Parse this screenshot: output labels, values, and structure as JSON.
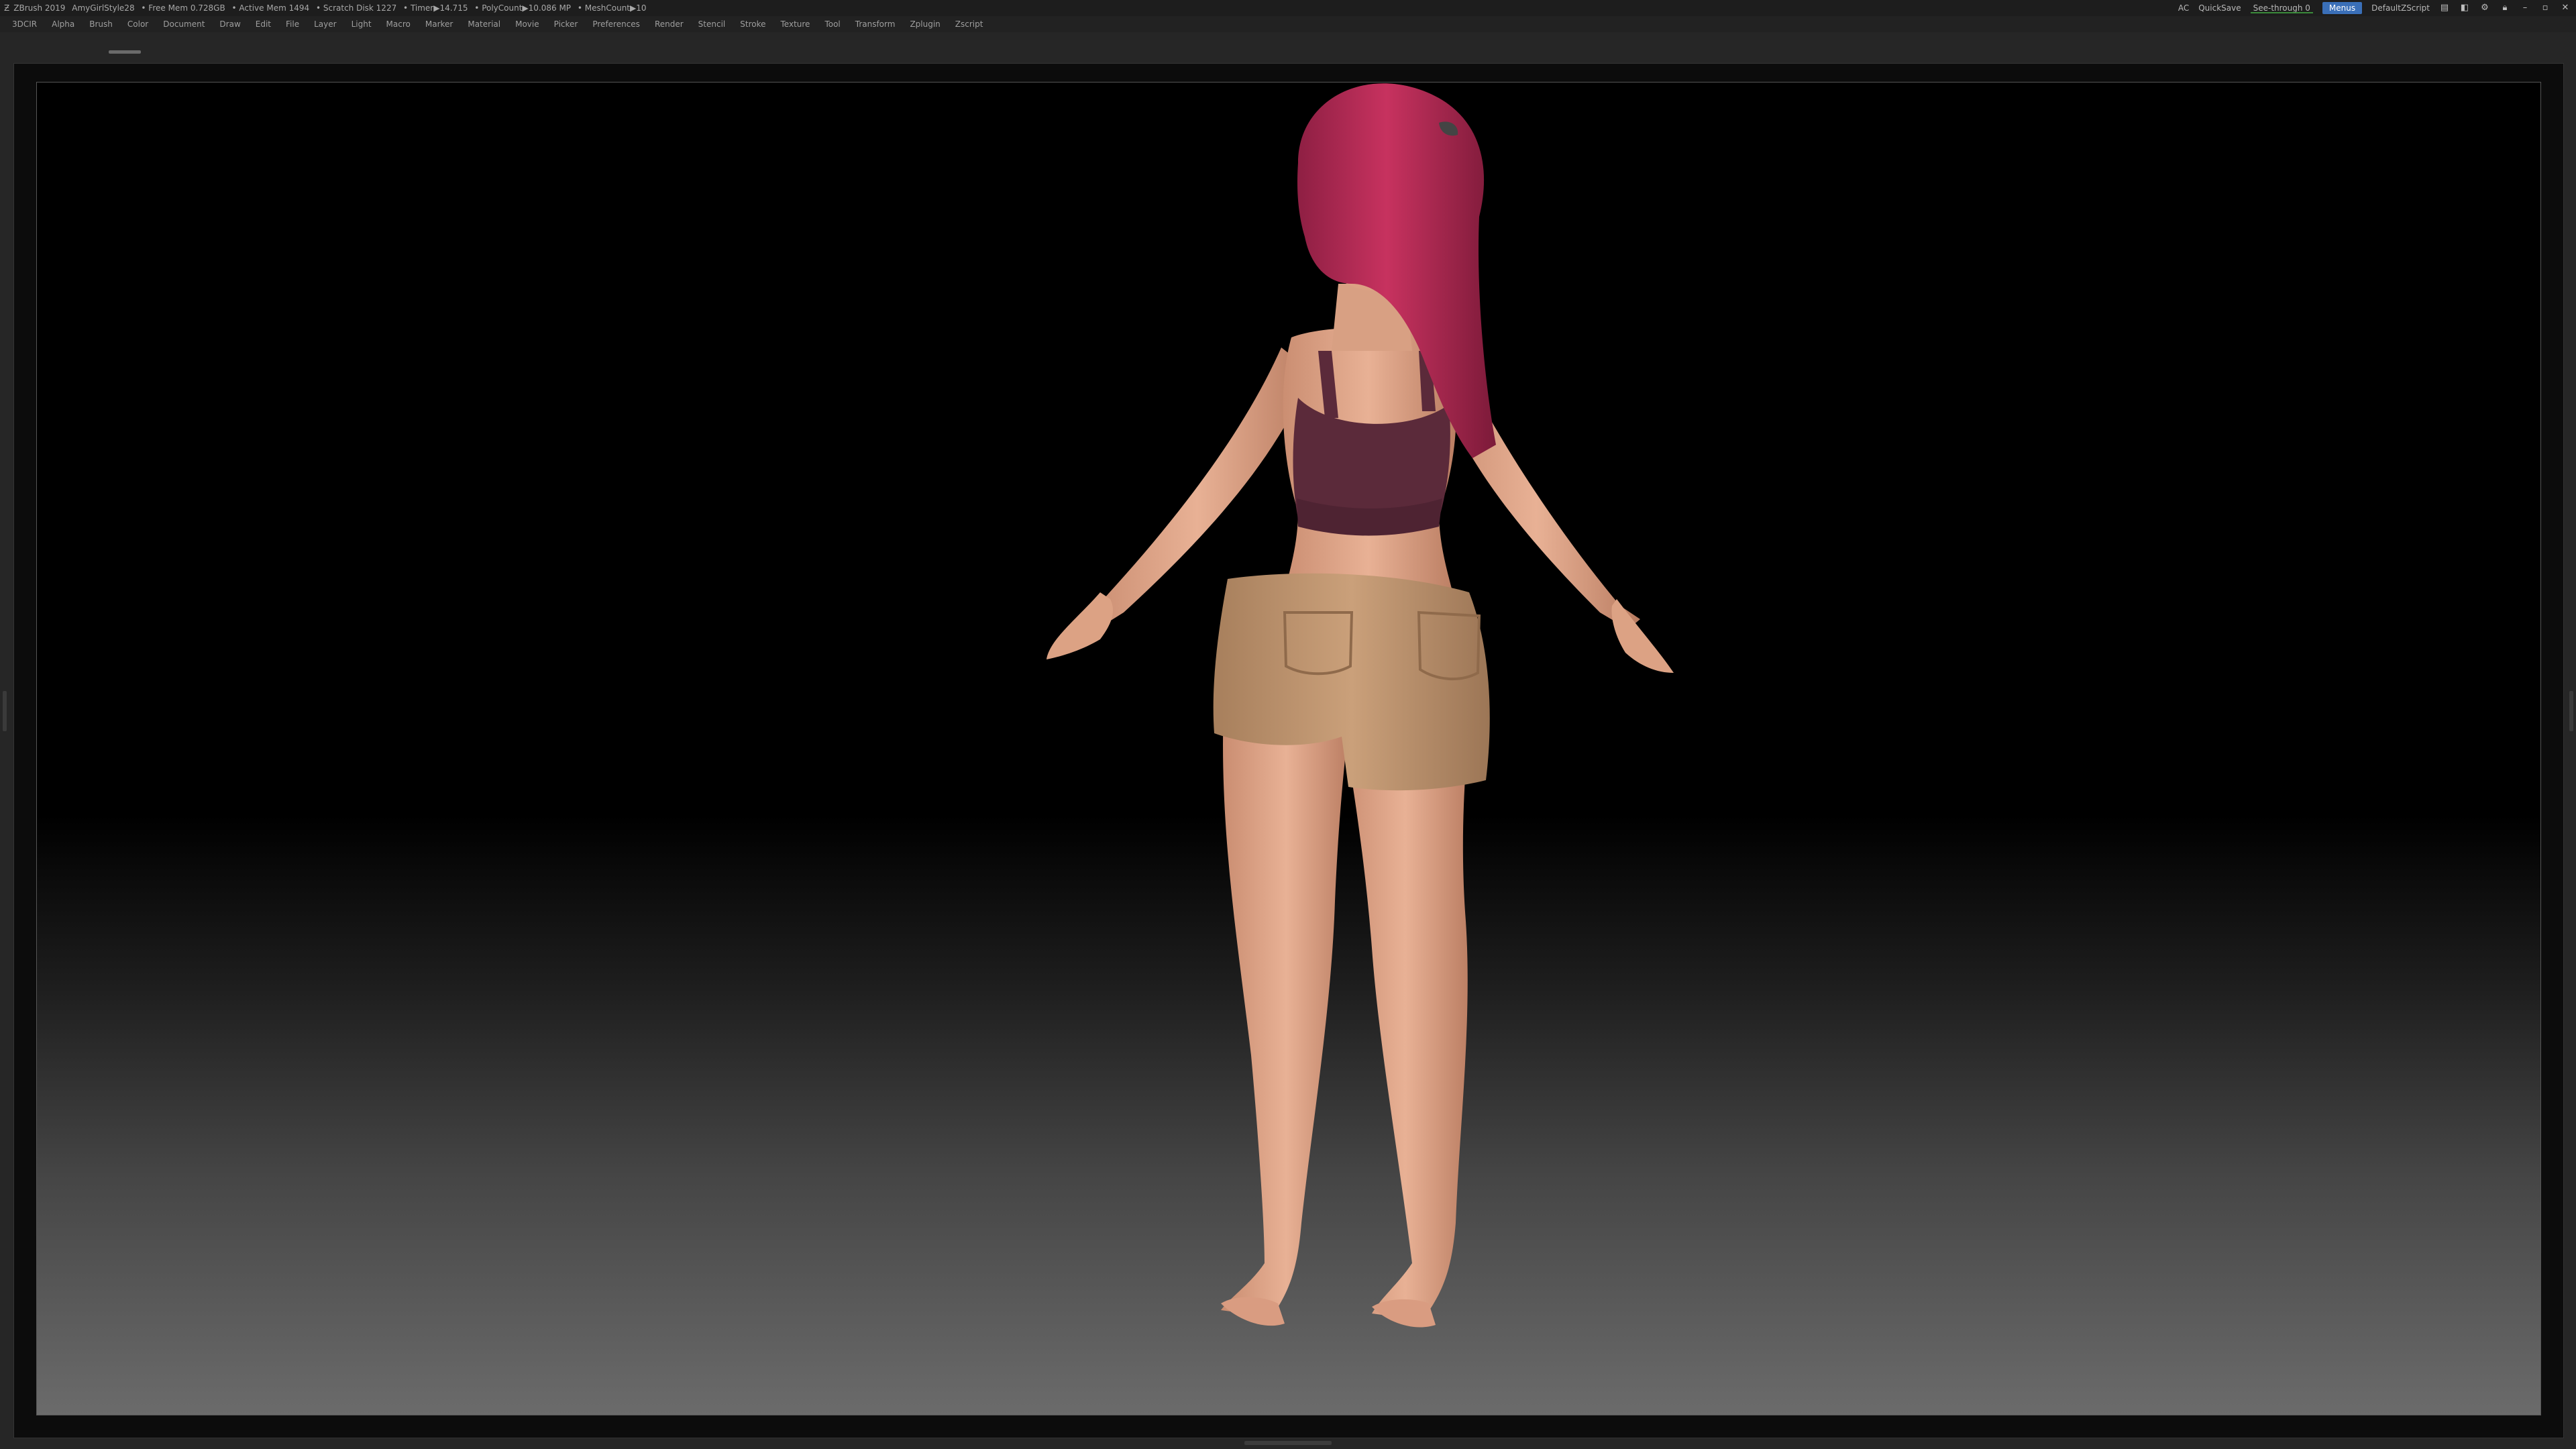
{
  "titlebar": {
    "app": "ZBrush 2019",
    "document": "AmyGirlStyle28",
    "free_mem": "• Free Mem 0.728GB",
    "active_mem": "• Active Mem 1494",
    "scratch_disk": "• Scratch Disk 1227",
    "timer": "• Timer▶14.715",
    "poly_count": "• PolyCount▶10.086 MP",
    "mesh_count": "• MeshCount▶10",
    "ac": "AC",
    "quicksave": "QuickSave",
    "see_through": "See-through 0",
    "menus": "Menus",
    "default_zscript": "DefaultZScript"
  },
  "menu": {
    "items": [
      "3DCIR",
      "Alpha",
      "Brush",
      "Color",
      "Document",
      "Draw",
      "Edit",
      "File",
      "Layer",
      "Light",
      "Macro",
      "Marker",
      "Material",
      "Movie",
      "Picker",
      "Preferences",
      "Render",
      "Stencil",
      "Stroke",
      "Texture",
      "Tool",
      "Transform",
      "Zplugin",
      "Zscript"
    ]
  },
  "colors": {
    "menus_button": "#3a6fb8",
    "hair": "#b32a55",
    "skin": "#e2a98b",
    "top": "#5b2a3a",
    "shorts": "#c49a73"
  },
  "icons": [
    "zbrush-logo-icon",
    "layout-icon",
    "palette-icon",
    "script-icon",
    "lock-icon",
    "minimize-icon",
    "maximize-icon",
    "close-icon"
  ]
}
